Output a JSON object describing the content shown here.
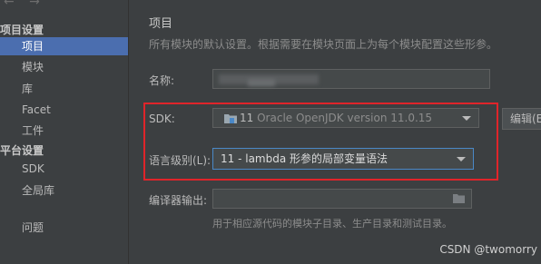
{
  "sidebar": {
    "nav_arrows": "← →",
    "project_settings_title": "项目设置",
    "project_items": [
      {
        "label": "项目"
      },
      {
        "label": "模块"
      },
      {
        "label": "库"
      },
      {
        "label": "Facet"
      },
      {
        "label": "工件"
      }
    ],
    "platform_settings_title": "平台设置",
    "platform_items": [
      {
        "label": "SDK"
      },
      {
        "label": "全局库"
      }
    ],
    "problems_label": "问题"
  },
  "main": {
    "title": "项目",
    "description": "所有模块的默认设置。根据需要在模块页面上为每个模块配置这些形参。",
    "name_label": "名称:",
    "sdk_label": "SDK:",
    "sdk_version_num": "11",
    "sdk_value": "Oracle OpenJDK version 11.0.15",
    "edit_button": "编辑(E)",
    "language_level_label": "语言级别(L):",
    "language_level_value": "11 - lambda 形参的局部变量语法",
    "compiler_output_label": "编译器输出:",
    "compiler_hint": "用于相应源代码的模块子目录、生产目录和测试目录。"
  },
  "watermark": "CSDN @twomorry",
  "colors": {
    "background": "#3c3f41",
    "selection": "#4b6eaf",
    "highlight_box": "#e0242a",
    "focus_border": "#4a88c7"
  }
}
